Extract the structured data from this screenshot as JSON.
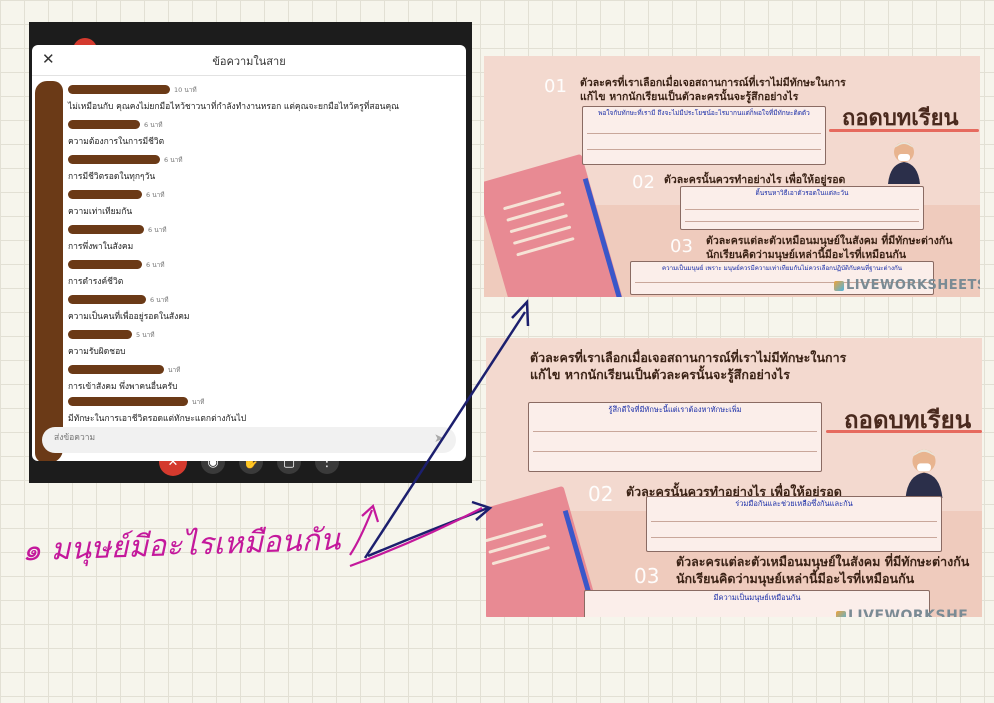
{
  "chat": {
    "title": "ข้อความในสาย",
    "close_icon": "close-icon",
    "messages": [
      {
        "time": "10 นาที",
        "text": "ไม่เหมือนกับ คุณคงไม่ยกมือไหว้ชาวนาที่กำลังทำงานหรอก แต่คุณจะยกมือไหว้ครูที่สอนคุณ"
      },
      {
        "time": "6 นาที",
        "text": "ความต้องการในการมีชีวิต"
      },
      {
        "time": "6 นาที",
        "text": "การมีชีวิตรอดในทุกๆวัน"
      },
      {
        "time": "6 นาที",
        "text": "ความเท่าเทียมกัน"
      },
      {
        "time": "6 นาที",
        "text": "การพึ่งพาในสังคม"
      },
      {
        "time": "6 นาที",
        "text": "การดำรงค์ชีวิต"
      },
      {
        "time": "6 นาที",
        "text": "ความเป็นคนที่เพื่ออยู่รอดในสังคม"
      },
      {
        "time": "5 นาที",
        "text": "ความรับผิดชอบ"
      },
      {
        "time": "นาที",
        "text": "การเข้าสังคม พึ่งพาคนอื่นครับ"
      },
      {
        "time": "นาที",
        "text": "มีทักษะในการเอาชีวิตรอดแต่ทักษะแตกต่างกันไป"
      }
    ],
    "composer_placeholder": "ส่งข้อความ",
    "send_icon": "send-icon"
  },
  "worksheets": [
    {
      "q1_number": "01",
      "q1_line1": "ตัวละครที่เราเลือกเมื่อเจอสถานการณ์ที่เราไม่มีทักษะในการ",
      "q1_line2": "แก้ไข หากนักเรียนเป็นตัวละครนั้นจะรู้สึกอย่างไร",
      "a1": "พอใจกับทักษะที่เรามี ถึงจะไม่มีประโยชน์อะไรมากนแต่ก็พอใจที่มีทักษะติดตัว",
      "q2_number": "02",
      "q2": "ตัวละครนั้นควรทำอย่างไร เพื่อให้อยู่รอด",
      "a2": "ดิ้นรนหาวิธีเอาตัวรอดในแต่ละวัน",
      "q3_number": "03",
      "q3_line1": "ตัวละครแต่ละตัวเหมือนมนุษย์ในสังคม ที่มีทักษะต่างกัน",
      "q3_line2": "นักเรียนคิดว่ามนุษย์เหล่านี้มีอะไรที่เหมือนกัน",
      "a3": "ความเป็นมนุษย์ เพราะ มนุษย์ควรมีความเท่าเทียมกันไม่ควรเลือกปฏิบัติกับคนที่ฐานะต่างกัน",
      "lesson_title": "ถอดบทเรียน",
      "logo": "LIVEWORKSHEETS"
    },
    {
      "q1_line1": "ตัวละครที่เราเลือกเมื่อเจอสถานการณ์ที่เราไม่มีทักษะในการ",
      "q1_line2": "แก้ไข หากนักเรียนเป็นตัวละครนั้นจะรู้สึกอย่างไร",
      "a1": "รู้สึกดีใจที่มีทักษะนี้แต่เราต้องหาทักษะเพิ่ม",
      "q2_number": "02",
      "q2": "ตัวละครนั้นควรทำอย่างไร เพื่อให้อยู่รอด",
      "a2": "ร่วมมือกันและช่วยเหลือซึ่งกันและกัน",
      "q3_number": "03",
      "q3_line1": "ตัวละครแต่ละตัวเหมือนมนุษย์ในสังคม ที่มีทักษะต่างกัน",
      "q3_line2": "นักเรียนคิดว่ามนุษย์เหล่านี้มีอะไรที่เหมือนกัน",
      "a3": "มีความเป็นมนุษย์เหมือนกัน",
      "lesson_title": "ถอดบทเรียน",
      "logo": "LIVEWORKSHE"
    }
  ],
  "annotation": {
    "handwriting": "๑ มนุษย์มีอะไรเหมือนกัน",
    "ink_colors": {
      "arrow": "#1c1f6e",
      "pen": "#c4189c"
    }
  },
  "colors": {
    "redaction": "#6b3a17",
    "worksheet_bg": "#f0d5ca",
    "answer_text": "#1a2ea8",
    "question_text": "#3b2316"
  }
}
